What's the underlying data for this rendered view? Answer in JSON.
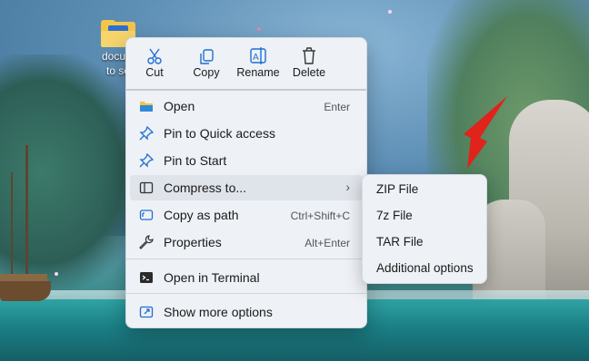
{
  "desktop": {
    "icon_label_line1": "docum",
    "icon_label_line2": "to se"
  },
  "context_menu": {
    "toolbar": [
      {
        "label": "Cut",
        "icon": "scissors-icon"
      },
      {
        "label": "Copy",
        "icon": "copy-icon"
      },
      {
        "label": "Rename",
        "icon": "rename-icon"
      },
      {
        "label": "Delete",
        "icon": "trash-icon"
      }
    ],
    "items": [
      {
        "label": "Open",
        "shortcut": "Enter",
        "icon": "folder-icon"
      },
      {
        "label": "Pin to Quick access",
        "shortcut": "",
        "icon": "pin-icon"
      },
      {
        "label": "Pin to Start",
        "shortcut": "",
        "icon": "pin-icon"
      },
      {
        "label": "Compress to...",
        "shortcut": "",
        "icon": "compress-icon",
        "submenu": true
      },
      {
        "label": "Copy as path",
        "shortcut": "Ctrl+Shift+C",
        "icon": "path-icon"
      },
      {
        "label": "Properties",
        "shortcut": "Alt+Enter",
        "icon": "wrench-icon"
      },
      {
        "label": "Open in Terminal",
        "shortcut": "",
        "icon": "terminal-icon"
      },
      {
        "label": "Show more options",
        "shortcut": "",
        "icon": "share-icon"
      }
    ]
  },
  "submenu": {
    "items": [
      {
        "label": "ZIP File"
      },
      {
        "label": "7z File"
      },
      {
        "label": "TAR File"
      },
      {
        "label": "Additional options"
      }
    ]
  },
  "colors": {
    "menu_bg": "#eef1f6",
    "highlight": "#dfe3ea",
    "icon_blue": "#1f6fd1",
    "arrow_red": "#e0231b"
  }
}
